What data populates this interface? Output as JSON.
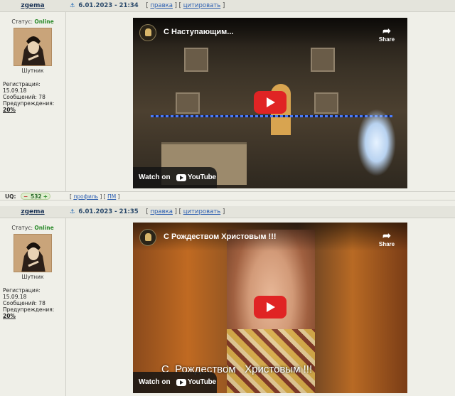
{
  "posts": [
    {
      "author": "zgema",
      "anchor_icon": "anchor-icon",
      "date": "6.01.2023 - 21:34",
      "edit_label": "правка",
      "quote_label": "цитировать",
      "status_label": "Статус:",
      "status_value": "Online",
      "rank": "Шутник",
      "reg_label": "Регистрация:",
      "reg_value": "15.09.18",
      "msgs_label": "Сообщений:",
      "msgs_value": "78",
      "warn_label": "Предупреждения:",
      "warn_value": "20%",
      "video": {
        "title": "С Наступающим...",
        "share": "Share",
        "watch_on": "Watch on",
        "youtube": "YouTube",
        "subtitle": ""
      }
    },
    {
      "author": "zgema",
      "anchor_icon": "anchor-icon",
      "date": "6.01.2023 - 21:35",
      "edit_label": "правка",
      "quote_label": "цитировать",
      "status_label": "Статус:",
      "status_value": "Online",
      "rank": "Шутник",
      "reg_label": "Регистрация:",
      "reg_value": "15.09.18",
      "msgs_label": "Сообщений:",
      "msgs_value": "78",
      "warn_label": "Предупреждения:",
      "warn_value": "20%",
      "video": {
        "title": "С Рождеством Христовым !!!",
        "share": "Share",
        "watch_on": "Watch on",
        "youtube": "YouTube",
        "subtitle": "С  Рождеством   Христовым !!!"
      }
    }
  ],
  "uq": {
    "label": "UQ:",
    "minus": "−",
    "value": "532",
    "plus": "+",
    "profile_label": "профиль",
    "pm_label": "ПМ"
  },
  "colors": {
    "online": "#2a8a2a",
    "link": "#2a5db0",
    "play": "#e02424",
    "header_bg": "#e4e4dc"
  }
}
